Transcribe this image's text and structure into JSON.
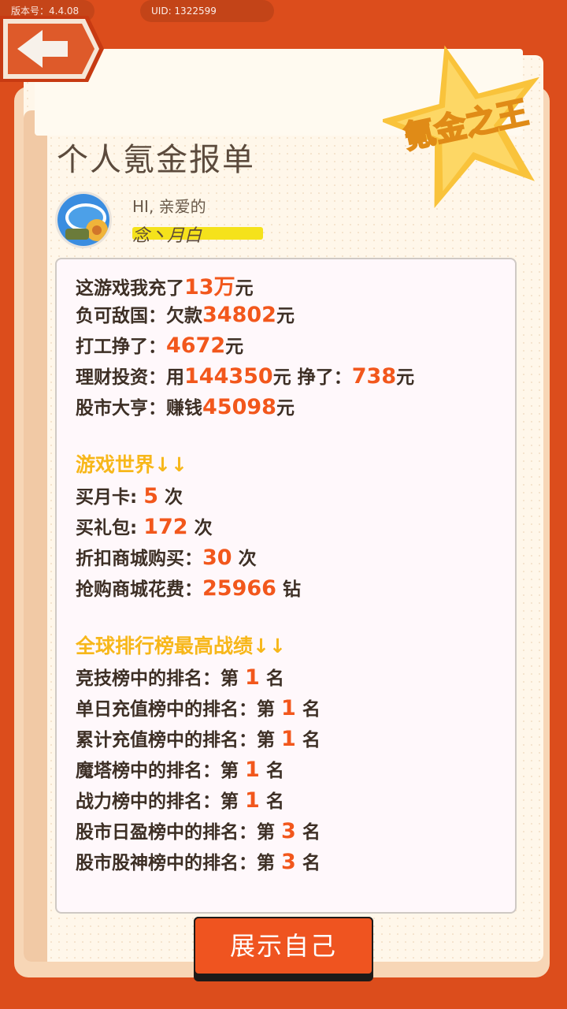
{
  "topbar": {
    "version": "版本号：4.4.08",
    "uid": "UID: 1322599"
  },
  "badge": {
    "text": "氪金之王"
  },
  "page_title": "个人氪金报单",
  "user": {
    "greeting": "HI, 亲爱的",
    "name": "念丶月白"
  },
  "stats": [
    {
      "label": "这游戏我充了",
      "value": "13万",
      "unit": "元"
    },
    {
      "label": "负可敌国：欠款",
      "value": "34802",
      "unit": "元"
    },
    {
      "label": "打工挣了：",
      "value": "4672",
      "unit": "元"
    },
    {
      "label": "理财投资：用",
      "value": "144350",
      "unit": "元",
      "label2": " 挣了：",
      "value2": "738",
      "unit2": "元"
    },
    {
      "label": "股市大亨：赚钱",
      "value": "45098",
      "unit": "元"
    }
  ],
  "game_section": {
    "title": "游戏世界↓↓",
    "items": [
      {
        "label": "买月卡: ",
        "value": "5",
        "unit": " 次"
      },
      {
        "label": "买礼包: ",
        "value": "172",
        "unit": " 次"
      },
      {
        "label": "折扣商城购买：",
        "value": "30",
        "unit": " 次"
      },
      {
        "label": "抢购商城花费：",
        "value": "25966",
        "unit": " 钻"
      }
    ]
  },
  "rank_section": {
    "title": "全球排行榜最高战绩↓↓",
    "items": [
      {
        "label": "竞技榜中的排名：第 ",
        "value": "1",
        "unit": " 名"
      },
      {
        "label": "单日充值榜中的排名：第 ",
        "value": "1",
        "unit": " 名"
      },
      {
        "label": "累计充值榜中的排名：第 ",
        "value": "1",
        "unit": " 名"
      },
      {
        "label": "魔塔榜中的排名：第 ",
        "value": "1",
        "unit": " 名"
      },
      {
        "label": "战力榜中的排名：第 ",
        "value": "1",
        "unit": " 名"
      },
      {
        "label": "股市日盈榜中的排名：第 ",
        "value": "3",
        "unit": " 名"
      },
      {
        "label": "股市股神榜中的排名：第 ",
        "value": "3",
        "unit": " 名"
      }
    ]
  },
  "button": {
    "label": "展示自己"
  },
  "colors": {
    "accent": "#f2571c",
    "section": "#f7b71a",
    "frame": "#dc4d1c"
  }
}
